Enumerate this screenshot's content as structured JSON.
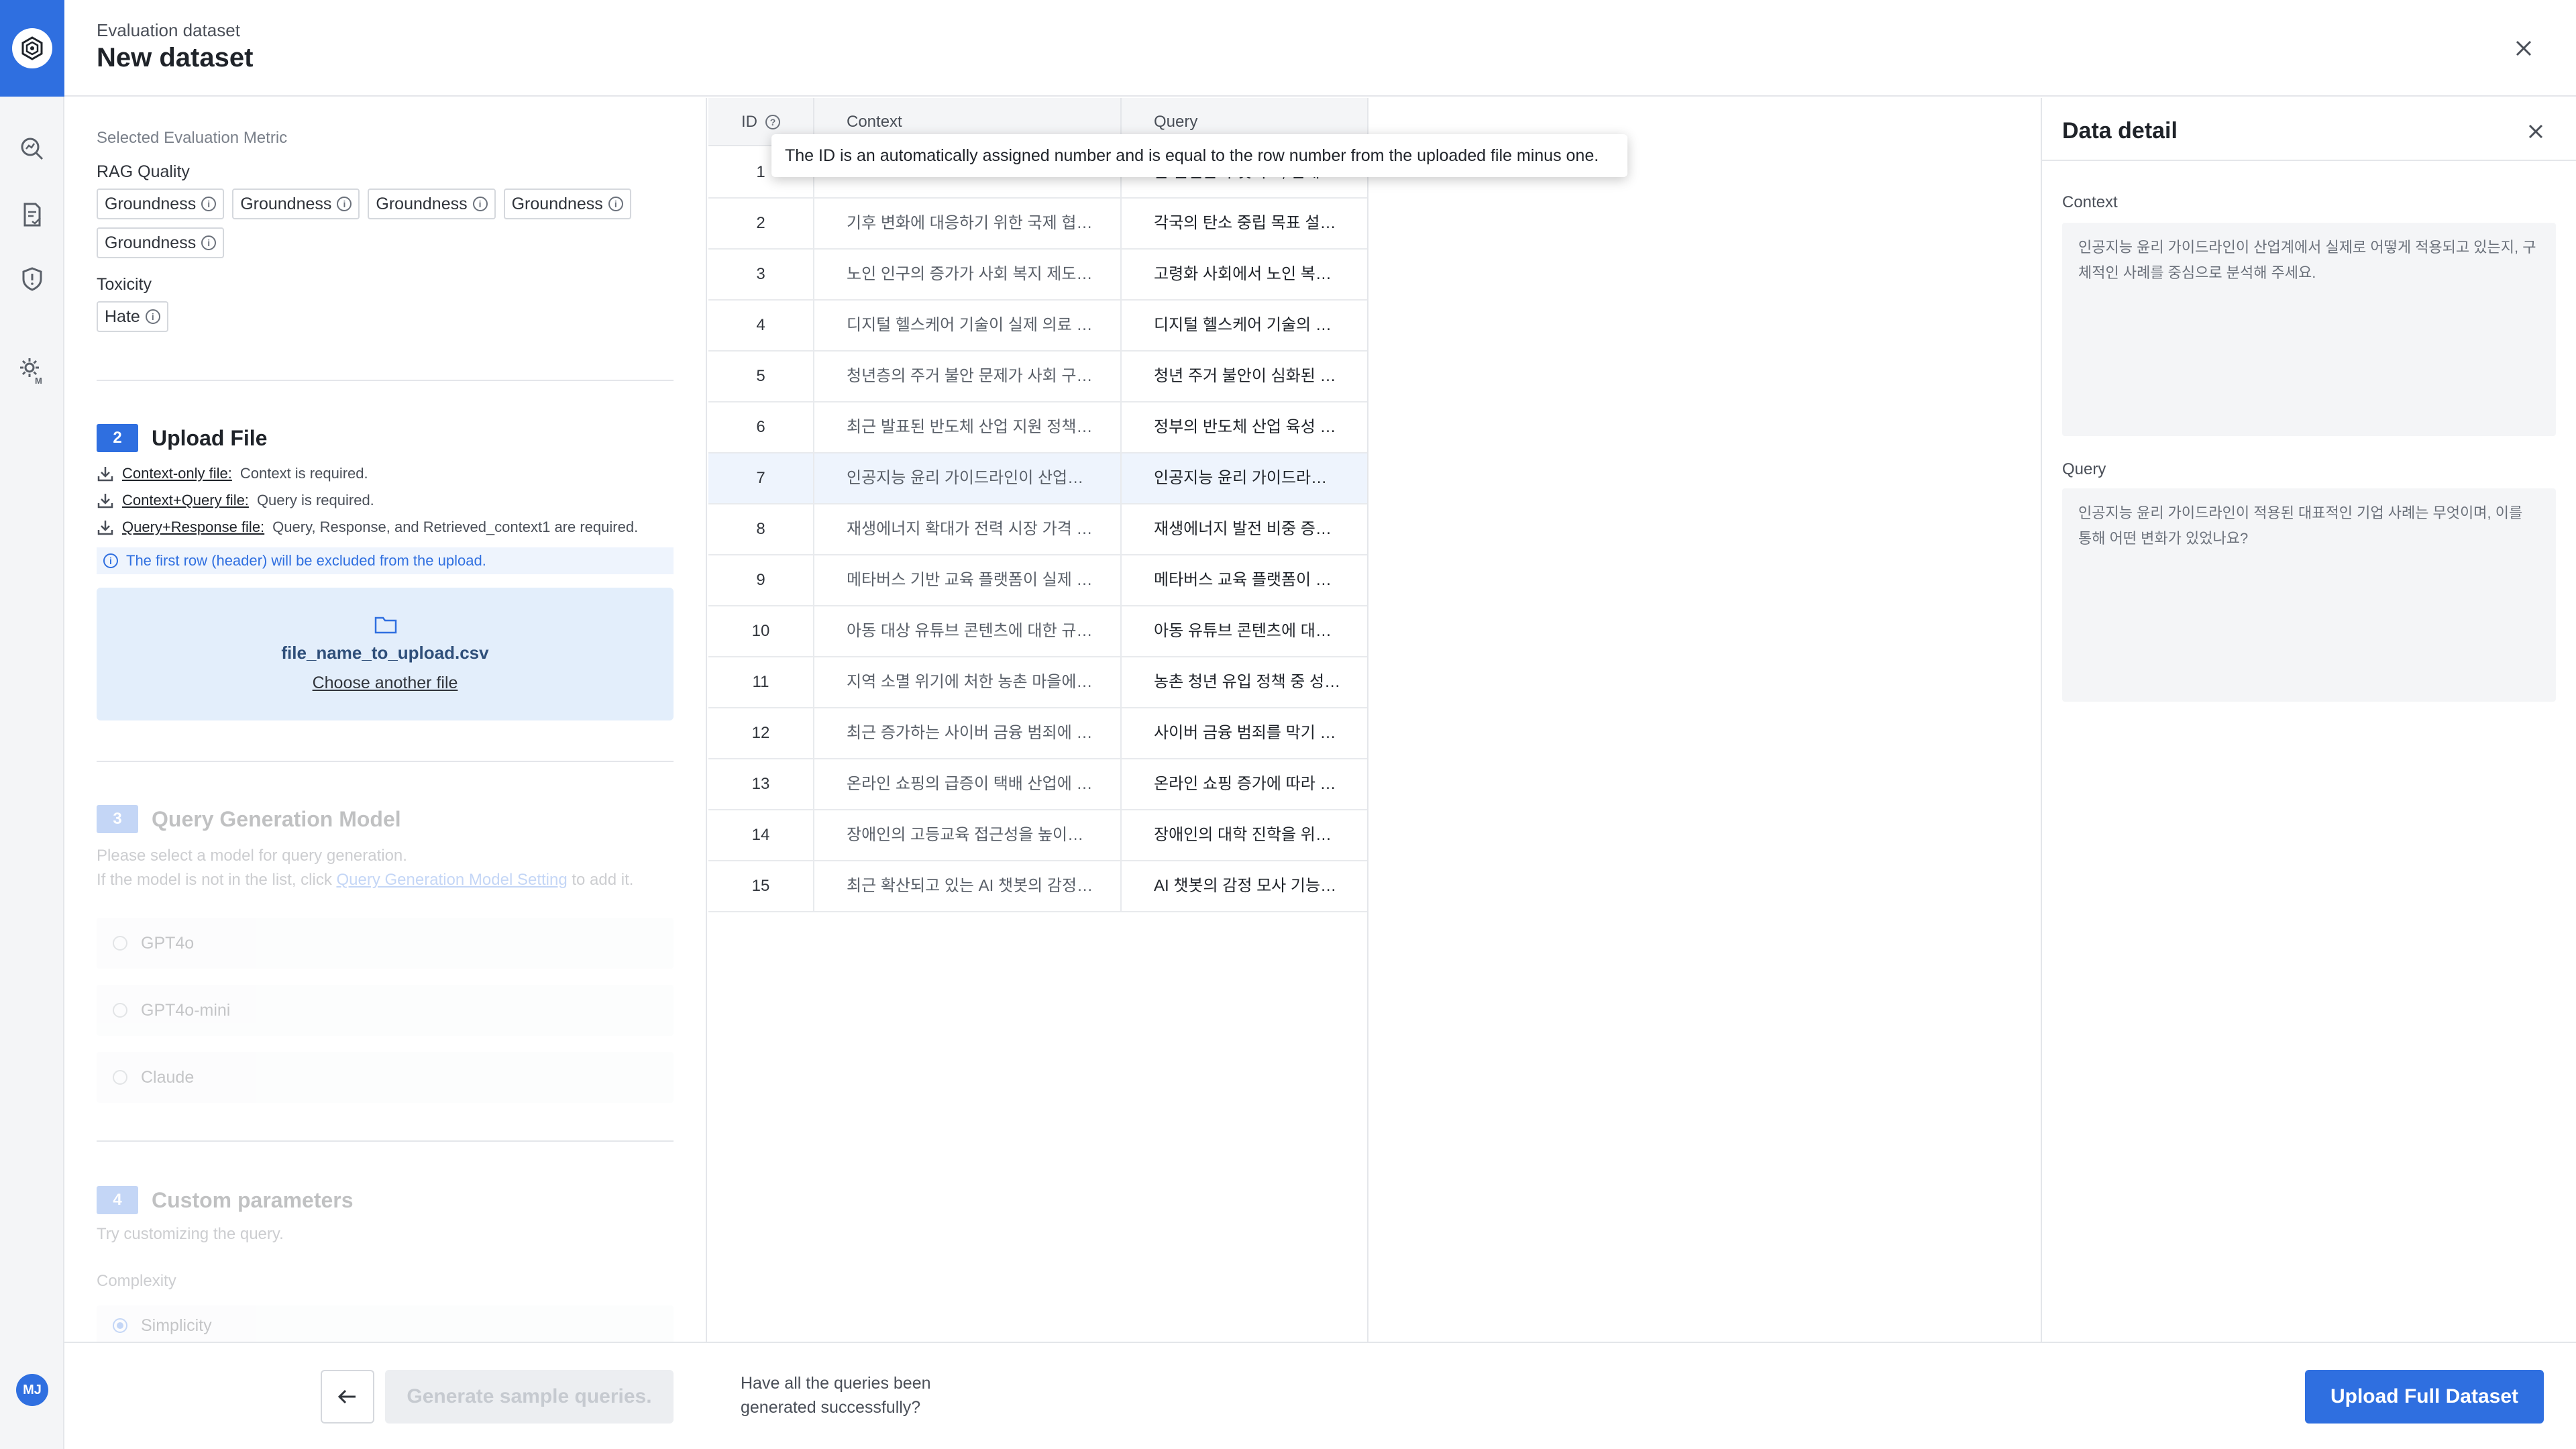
{
  "header": {
    "eyebrow": "Evaluation dataset",
    "title": "New dataset"
  },
  "rail": {
    "avatar_initials": "MJ"
  },
  "metrics": {
    "section_label": "Selected Evaluation Metric",
    "groups": [
      {
        "name": "RAG Quality",
        "chips": [
          "Groundness",
          "Groundness",
          "Groundness",
          "Groundness",
          "Groundness"
        ]
      },
      {
        "name": "Toxicity",
        "chips": [
          "Hate"
        ]
      }
    ]
  },
  "upload": {
    "step": "2",
    "title": "Upload File",
    "file_types": [
      {
        "link": "Context-only file:",
        "desc": "Context is required."
      },
      {
        "link": "Context+Query file:",
        "desc": "Query is required."
      },
      {
        "link": "Query+Response file:",
        "desc": "Query, Response, and Retrieved_context1 are required."
      }
    ],
    "notice": "The first row (header) will be excluded from the upload.",
    "file_name": "file_name_to_upload.csv",
    "choose_label": "Choose another file"
  },
  "query_model": {
    "step": "3",
    "title": "Query Generation Model",
    "desc1": "Please select a model for query generation.",
    "desc2_prefix": "If the model is not in the list, click ",
    "desc2_link": "Query Generation Model Setting",
    "desc2_suffix": " to add it.",
    "options": [
      "GPT4o",
      "GPT4o-mini",
      "Claude"
    ]
  },
  "custom_params": {
    "step": "4",
    "title": "Custom parameters",
    "desc": "Try customizing the query.",
    "complexity_label": "Complexity",
    "complexity_value": "Simplicity"
  },
  "table": {
    "columns": {
      "id": "ID",
      "context": "Context",
      "query": "Query"
    },
    "tooltip": "The ID is an automatically assigned number and is equal to the row number from the uploaded file minus one.",
    "rows": [
      {
        "id": "1",
        "context": "",
        "query": "는 원인은 무엇이고, 현재 시행 중인 대표적인 안전 대책은 무엇인가요?"
      },
      {
        "id": "2",
        "context": "기후 변화에 대응하기 위한 국제 협력 방안과 각국의 탄소 중립 정책 차이를 비교 분석해 주세요.",
        "query": "각국의 탄소 중립 목표 설정과 실현 전략은 어떻게 다르고, 국제 협력에서 발생하는 문제는 무엇인가요?"
      },
      {
        "id": "3",
        "context": "노인 인구의 증가가 사회 복지 제도에 미치는 영향을 분석하고, 고령화 사회를 대비한 정책을 제안해 주세요.",
        "query": "고령화 사회에서 노인 복지 지출은 어떤 방식으로 증가하고 있으며, 이를 대비한 정책은 무엇인가요?"
      },
      {
        "id": "4",
        "context": "디지털 헬스케어 기술이 실제 의료 현장에서 어떻게 활용되고 있는지, 그 효과성과 한계를 설명해 주세요.",
        "query": "디지털 헬스케어 기술의 도입이 실제 환자 진료 및 치료에 미친 긍정적 효과와 그 한계점을 알려주세요."
      },
      {
        "id": "5",
        "context": "청년층의 주거 불안 문제가 사회 구조적으로 어떻게 형성되었는지와 이를 완화할 수 있는 정책을 설명해 주세요.",
        "query": "청년 주거 불안이 심화된 배경에는 어떤 구조적 문제가 있으며, 이를 해결하기 위한 정책은 무엇인가요?"
      },
      {
        "id": "6",
        "context": "최근 발표된 반도체 산업 지원 정책의 주요 내용과 이에 따른 국내 기업들의 투자 확대 현황을 알려주세요.",
        "query": "정부의 반도체 산업 육성 정책 발표 이후, 국내 기업들이 추진하고 있는 주요 투자 방향은 무엇인가요?"
      },
      {
        "id": "7",
        "context": "인공지능 윤리 가이드라인이 산업계에서 실제로 어떻게 적용되고 있는지, 구체적인 사례를 중심으로 분석해 주세요.",
        "query": "인공지능 윤리 가이드라인이 적용된 대표적인 기업 사례는 무엇이며, 이를 통해 어떤 변화가 있었나요?"
      },
      {
        "id": "8",
        "context": "재생에너지 확대가 전력 시장 가격 변동성에 어떤 영향을 미쳤는지, 최근 데이터와 함께 설명해 주세요.",
        "query": "재생에너지 발전 비중 증가가 전력 시장의 가격 안정성에 어떤 긍정적·부정적 영향을 주었나요?"
      },
      {
        "id": "9",
        "context": "메타버스 기반 교육 플랫폼이 실제 학습자의 몰입도와 학업 성취에 어떤 영향을 주었는지 설명해 주세요.",
        "query": "메타버스 교육 플랫폼이 학습자들의 학습 동기와 성취도에 미친 영향을 보여주는 연구 결과가 있나요?"
      },
      {
        "id": "10",
        "context": "아동 대상 유튜브 콘텐츠에 대한 규제가 강화된 이후 콘텐츠 제작자들이 어떤 방식으로 대응했는지 알려주세요.",
        "query": "아동 유튜브 콘텐츠에 대한 규제 강화 이후, 콘텐츠 제작자들이 보인 전략적 변화는 무엇인가요?"
      },
      {
        "id": "11",
        "context": "지역 소멸 위기에 처한 농촌 마을에서 청년 유입을 유도하기 위한 정책 실험 사례를 알려주세요.",
        "query": "농촌 청년 유입 정책 중 성공적으로 평가받는 사례는 어떤 것이 있고, 그 핵심 요인은 무엇인가요?"
      },
      {
        "id": "12",
        "context": "최근 증가하는 사이버 금융 범죄에 대응하기 위해 도입된 보안 기술과 정책 대응 사례를 알려주세요.",
        "query": "사이버 금융 범죄를 막기 위해 최근 도입된 보안 기술에는 어떤 것들이 있으며, 실제 효과는 어떤가요?"
      },
      {
        "id": "13",
        "context": "온라인 쇼핑의 급증이 택배 산업에 미친 영향과 택배 노동자의 근무 환경 변화에 대해 설명해 주세요.",
        "query": "온라인 쇼핑 증가에 따라 택배 산업은 어떻게 변화했고, 특히 노동자들의 근무 환경은 어떻게 달라졌나요?"
      },
      {
        "id": "14",
        "context": "장애인의 고등교육 접근성을 높이기 위해 시행된 제도들의 효과와 한계에 대해 평가해 주세요.",
        "query": "장애인의 대학 진학을 위한 제도 중 실질적인 도움이 되었던 정책은 무엇이며, 여전히 남은 과제는 무엇인가요?"
      },
      {
        "id": "15",
        "context": "최근 확산되고 있는 AI 챗봇의 감정 모사 기능이 사용자 경험에 어떤 긍정적·부정적 영향을 주는지 설명해 주세요.",
        "query": "AI 챗봇의 감정 모사 기능이 사용자에게 긍정적인 경험을 제공한 사례와 부정적인 사례는 무엇인가요?"
      }
    ]
  },
  "detail": {
    "title": "Data detail",
    "context_label": "Context",
    "context_value": "인공지능 윤리 가이드라인이 산업계에서 실제로 어떻게 적용되고 있는지, 구체적인 사례를 중심으로 분석해 주세요.",
    "query_label": "Query",
    "query_value": "인공지능 윤리 가이드라인이 적용된 대표적인 기업 사례는 무엇이며, 이를 통해 어떤 변화가 있었나요?"
  },
  "footer": {
    "generate_label": "Generate sample queries.",
    "question": "Have all the queries been generated successfully?",
    "upload_label": "Upload Full Dataset"
  },
  "colors": {
    "accent": "#2f6fe0",
    "selected_row": "#eef4fd",
    "dropzone": "#e3eefb"
  }
}
